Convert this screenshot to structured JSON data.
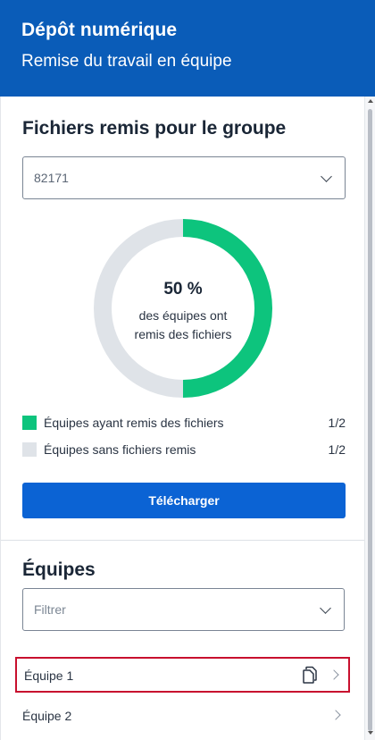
{
  "header": {
    "title": "Dépôt numérique",
    "subtitle": "Remise du travail en équipe"
  },
  "submitted": {
    "title": "Fichiers remis pour le groupe",
    "group_select_value": "82171",
    "donut": {
      "percent_text": "50 %",
      "caption": "des équipes ont remis des fichiers"
    },
    "legend": [
      {
        "label": "Équipes ayant remis des fichiers",
        "count": "1/2",
        "color": "#0dc47d"
      },
      {
        "label": "Équipes sans fichiers remis",
        "count": "1/2",
        "color": "#dfe3e8"
      }
    ],
    "download_label": "Télécharger"
  },
  "teams": {
    "title": "Équipes",
    "filter_placeholder": "Filtrer",
    "items": [
      {
        "name": "Équipe 1",
        "has_files": true,
        "icon": "file-icon"
      },
      {
        "name": "Équipe 2",
        "has_files": false
      }
    ]
  },
  "chart_data": {
    "type": "pie",
    "categories": [
      "Équipes ayant remis des fichiers",
      "Équipes sans fichiers remis"
    ],
    "values": [
      1,
      1
    ],
    "colors": [
      "#0dc47d",
      "#dfe3e8"
    ]
  }
}
